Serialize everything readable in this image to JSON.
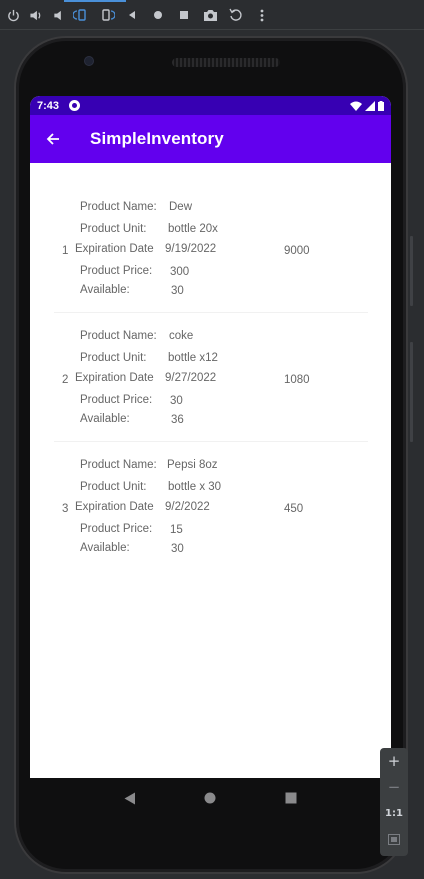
{
  "emulator_toolbar": {
    "icons": [
      "power-icon",
      "volume-up-icon",
      "volume-down-icon",
      "rotate-left-icon",
      "rotate-right-icon",
      "back-icon",
      "home-icon",
      "overview-icon",
      "camera-icon",
      "replay-icon",
      "more-icon"
    ]
  },
  "status_bar": {
    "time": "7:43"
  },
  "app_bar": {
    "title": "SimpleInventory"
  },
  "labels": {
    "product_name": "Product Name:",
    "product_unit": "Product Unit:",
    "expiration_date": "Expiration Date",
    "product_price": "Product Price:",
    "available": "Available:"
  },
  "products": [
    {
      "index": "1",
      "name": "Dew",
      "unit": "bottle 20x",
      "expiration": "9/19/2022",
      "total": "9000",
      "price": "300",
      "available": "30"
    },
    {
      "index": "2",
      "name": "coke",
      "unit": "bottle x12",
      "expiration": "9/27/2022",
      "total": "1080",
      "price": "30",
      "available": "36"
    },
    {
      "index": "3",
      "name": "Pepsi 8oz",
      "unit": "bottle x 30",
      "expiration": "9/2/2022",
      "total": "450",
      "price": "15",
      "available": "30"
    }
  ],
  "zoom_controls": {
    "zoom_in": "+",
    "zoom_out": "−",
    "actual_size": "1:1"
  }
}
